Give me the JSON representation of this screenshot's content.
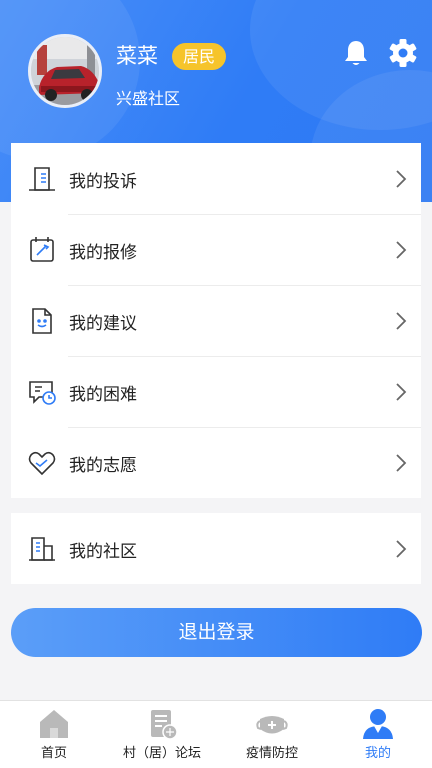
{
  "profile": {
    "name": "菜菜",
    "role_badge": "居民",
    "community": "兴盛社区"
  },
  "header_icons": [
    "bell-icon",
    "gear-icon"
  ],
  "menu_main": [
    {
      "label": "我的投诉",
      "icon": "complaint-icon"
    },
    {
      "label": "我的报修",
      "icon": "repair-icon"
    },
    {
      "label": "我的建议",
      "icon": "suggestion-icon"
    },
    {
      "label": "我的困难",
      "icon": "difficulty-icon"
    },
    {
      "label": "我的志愿",
      "icon": "volunteer-icon"
    }
  ],
  "menu_community": [
    {
      "label": "我的社区",
      "icon": "community-icon"
    }
  ],
  "logout_label": "退出登录",
  "tabs": [
    {
      "label": "首页",
      "icon": "home-icon",
      "active": false
    },
    {
      "label": "村（居）论坛",
      "icon": "forum-icon",
      "active": false
    },
    {
      "label": "疫情防控",
      "icon": "epidemic-icon",
      "active": false
    },
    {
      "label": "我的",
      "icon": "profile-icon",
      "active": true
    }
  ],
  "colors": {
    "primary": "#2f7cf6",
    "badge": "#f6c42b",
    "background": "#f4f4f6",
    "tab_inactive_icon": "#b9b9b9"
  }
}
